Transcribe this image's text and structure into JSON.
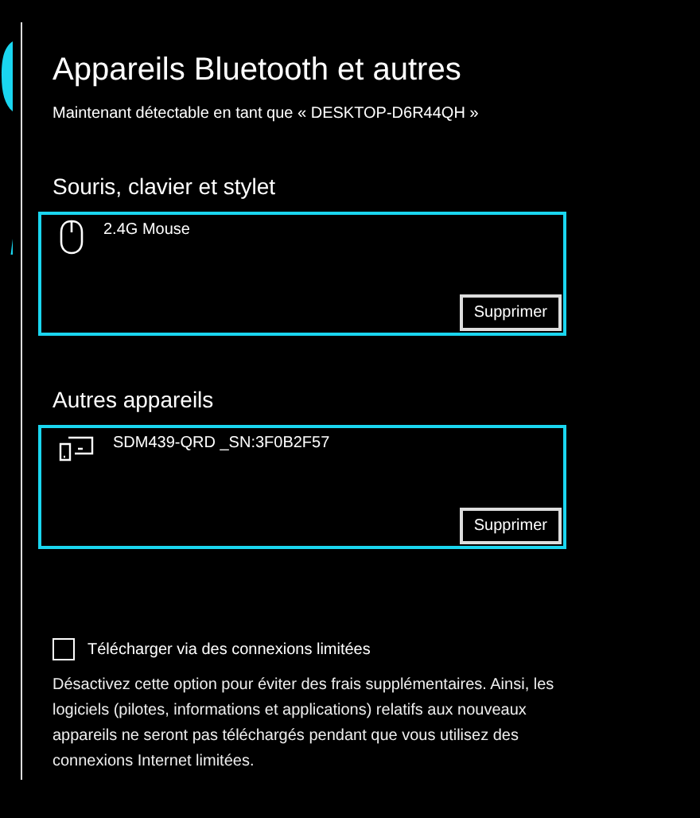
{
  "title": "Appareils Bluetooth et autres",
  "subtitle": "Maintenant détectable en tant que « DESKTOP-D6R44QH »",
  "sections": [
    {
      "heading": "Souris, clavier et stylet",
      "devices": [
        {
          "kind": "mouse",
          "name": "2.4G Mouse",
          "button": "Supprimer"
        }
      ]
    },
    {
      "heading": "Autres appareils",
      "devices": [
        {
          "kind": "devices",
          "name": "SDM439-QRD _SN:3F0B2F57",
          "button": "Supprimer"
        }
      ]
    }
  ],
  "metered": {
    "label": "Télécharger via des connexions limitées",
    "checked": false,
    "description": "Désactivez cette option pour éviter des frais supplémentaires. Ainsi, les logiciels (pilotes, informations et applications) relatifs aux nouveaux appareils ne seront pas téléchargés pendant que vous utilisez des connexions Internet limitées."
  }
}
